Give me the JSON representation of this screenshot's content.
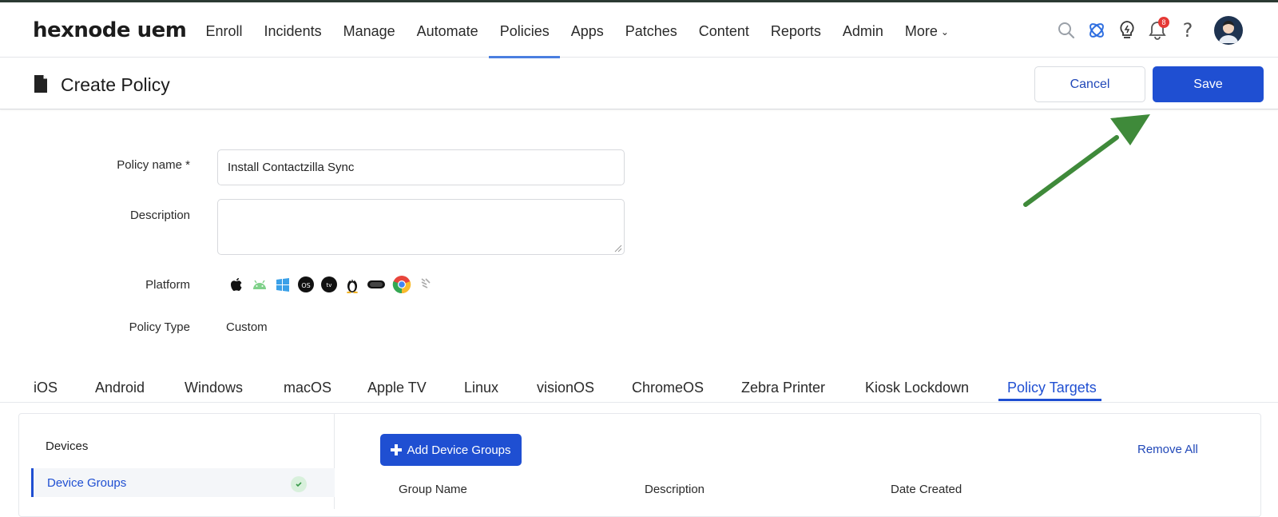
{
  "app": {
    "logo_text": "hexnode uem"
  },
  "nav": {
    "items": [
      {
        "label": "Enroll",
        "active": false
      },
      {
        "label": "Incidents",
        "active": false
      },
      {
        "label": "Manage",
        "active": false
      },
      {
        "label": "Automate",
        "active": false
      },
      {
        "label": "Policies",
        "active": true
      },
      {
        "label": "Apps",
        "active": false
      },
      {
        "label": "Patches",
        "active": false
      },
      {
        "label": "Content",
        "active": false
      },
      {
        "label": "Reports",
        "active": false
      },
      {
        "label": "Admin",
        "active": false
      },
      {
        "label": "More",
        "active": false
      }
    ],
    "notification_count": "8",
    "icons": [
      "search-icon",
      "hexnode-ai-icon",
      "lightbulb-icon",
      "bell-icon",
      "help-icon",
      "avatar"
    ]
  },
  "page": {
    "title": "Create Policy",
    "cancel_label": "Cancel",
    "save_label": "Save"
  },
  "form": {
    "policy_name_label": "Policy name *",
    "policy_name_value": "Install Contactzilla Sync",
    "description_label": "Description",
    "description_value": "",
    "platform_label": "Platform",
    "platforms": [
      "apple-icon",
      "android-icon",
      "windows-icon",
      "macos-icon",
      "apple-tv-icon",
      "linux-icon",
      "visionos-icon",
      "chrome-icon",
      "zebra-icon"
    ],
    "policy_type_label": "Policy Type",
    "policy_type_value": "Custom"
  },
  "tabs": [
    {
      "label": "iOS",
      "active": false
    },
    {
      "label": "Android",
      "active": false
    },
    {
      "label": "Windows",
      "active": false
    },
    {
      "label": "macOS",
      "active": false
    },
    {
      "label": "Apple TV",
      "active": false
    },
    {
      "label": "Linux",
      "active": false
    },
    {
      "label": "visionOS",
      "active": false
    },
    {
      "label": "ChromeOS",
      "active": false
    },
    {
      "label": "Zebra Printer",
      "active": false
    },
    {
      "label": "Kiosk Lockdown",
      "active": false
    },
    {
      "label": "Policy Targets",
      "active": true
    }
  ],
  "targets": {
    "side_items": [
      {
        "label": "Devices",
        "active": false
      },
      {
        "label": "Device Groups",
        "active": true
      }
    ],
    "add_button_label": "Add Device Groups",
    "remove_all_label": "Remove All",
    "columns": [
      "Group Name",
      "Description",
      "Date Created"
    ]
  },
  "colors": {
    "primary": "#1f4fd2",
    "nav_active_underline": "#4a7fe0",
    "annotation_arrow": "#3f8a3a"
  }
}
